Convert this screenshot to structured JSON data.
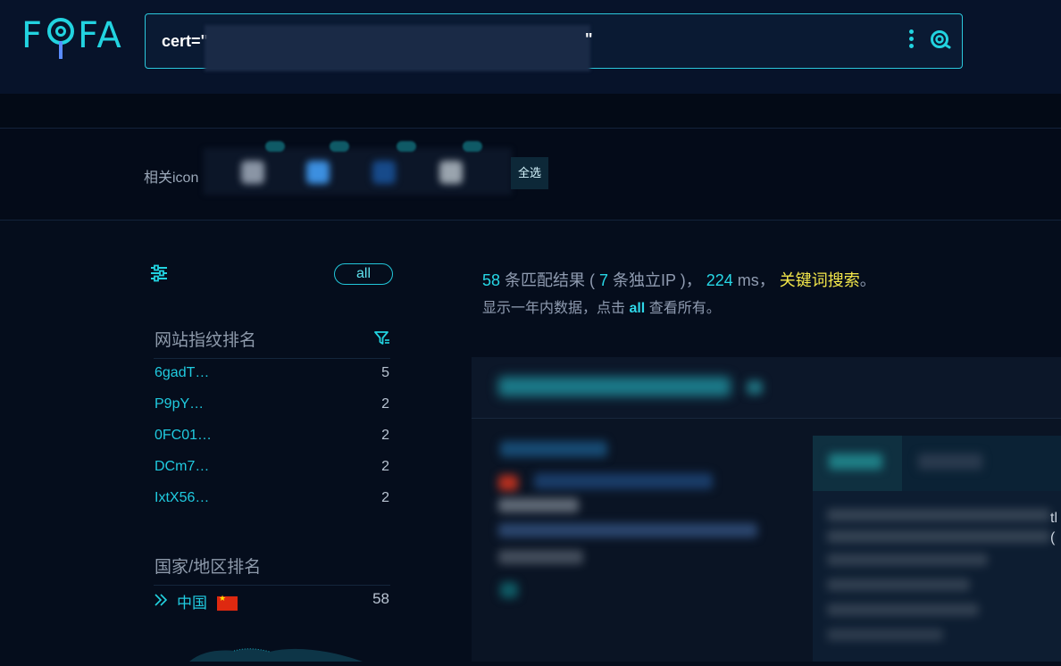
{
  "logo": {
    "text_left": "F",
    "text_right": "FA"
  },
  "search": {
    "query_prefix": "cert=\"",
    "query_suffix": "\"",
    "menu_icon": "kebab-icon",
    "submit_icon": "search-icon"
  },
  "related_icons": {
    "label": "相关icon",
    "select_all": "全选"
  },
  "sidebar": {
    "all_label": "all",
    "fingerprint_title": "网站指纹排名",
    "fingerprints": [
      {
        "name": "6gadT…",
        "count": "5"
      },
      {
        "name": "P9pY…",
        "count": "2"
      },
      {
        "name": "0FC01…",
        "count": "2"
      },
      {
        "name": "DCm7…",
        "count": "2"
      },
      {
        "name": "IxtX56…",
        "count": "2"
      }
    ],
    "country_title": "国家/地区排名",
    "countries": [
      {
        "name": "中国",
        "count": "58",
        "flag": "cn-flag"
      }
    ]
  },
  "results": {
    "match_count": "58",
    "match_text": " 条匹配结果 ( ",
    "ip_count": "7",
    "ip_text": " 条独立IP )， ",
    "time_value": "224",
    "time_text": " ms， ",
    "keyword_search": "关键词搜索",
    "period_mark": "。",
    "note_prefix": "显示一年内数据，点击 ",
    "note_link": "all",
    "note_suffix": " 查看所有。"
  },
  "edge_fragment": {
    "line1": "tl",
    "line2": "("
  },
  "colors": {
    "accent": "#22d3e0",
    "keyword": "#f4e74a",
    "background": "#050d1c"
  }
}
